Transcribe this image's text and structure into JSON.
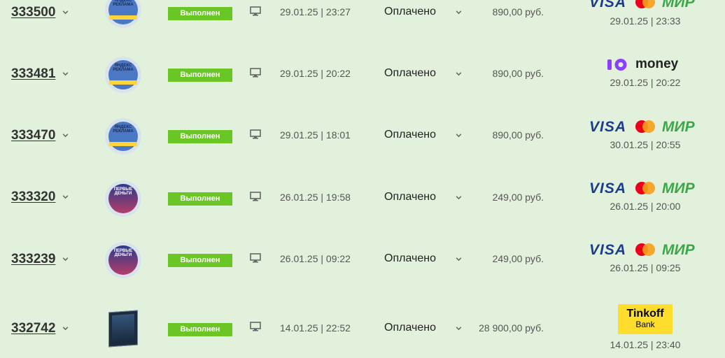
{
  "orders": [
    {
      "id": "333500",
      "status_badge": "Выполнен",
      "date": "29.01.25 | 23:27",
      "payment_status": "Оплачено",
      "price": "890,00 руб.",
      "payment_method": "visa-mastercard-mir",
      "paid_at": "29.01.25 | 23:33",
      "thumb_caption": "ЯНДЕКС РЕКЛАМА"
    },
    {
      "id": "333481",
      "status_badge": "Выполнен",
      "date": "29.01.25 | 20:22",
      "payment_status": "Оплачено",
      "price": "890,00 руб.",
      "payment_method": "yoomoney",
      "paid_at": "29.01.25 | 20:22",
      "thumb_caption": "ЯНДЕКС РЕКЛАМА"
    },
    {
      "id": "333470",
      "status_badge": "Выполнен",
      "date": "29.01.25 | 18:01",
      "payment_status": "Оплачено",
      "price": "890,00 руб.",
      "payment_method": "visa-mastercard-mir",
      "paid_at": "30.01.25 | 20:55",
      "thumb_caption": "ЯНДЕКС РЕКЛАМА"
    },
    {
      "id": "333320",
      "status_badge": "Выполнен",
      "date": "26.01.25 | 19:58",
      "payment_status": "Оплачено",
      "price": "249,00 руб.",
      "payment_method": "visa-mastercard-mir",
      "paid_at": "26.01.25 | 20:00",
      "thumb_caption": "ПЕРВЫЕ ДЕНЬГИ"
    },
    {
      "id": "333239",
      "status_badge": "Выполнен",
      "date": "26.01.25 | 09:22",
      "payment_status": "Оплачено",
      "price": "249,00 руб.",
      "payment_method": "visa-mastercard-mir",
      "paid_at": "26.01.25 | 09:25",
      "thumb_caption": "ПЕРВЫЕ ДЕНЬГИ"
    },
    {
      "id": "332742",
      "status_badge": "Выполнен",
      "date": "14.01.25 | 22:52",
      "payment_status": "Оплачено",
      "price": "28 900,00 руб.",
      "payment_method": "tinkoff",
      "paid_at": "14.01.25 | 23:40",
      "thumb_caption": ""
    }
  ],
  "payment_logos": {
    "visa": "VISA",
    "mir": "МИР",
    "yoomoney": "money",
    "tinkoff_name": "Tinkoff",
    "tinkoff_sub": "Bank"
  },
  "colors": {
    "badge": "#6ac624",
    "background": "#e2f1db",
    "visa": "#1a3b8f",
    "mir": "#3aa846",
    "yoomoney": "#8b3ffd",
    "tinkoff": "#ffdd2d"
  },
  "icons": {
    "order_toggle": "chevron-down-icon",
    "device": "monitor-icon",
    "status_toggle": "chevron-down-icon",
    "mastercard": "mastercard-logo-icon"
  }
}
